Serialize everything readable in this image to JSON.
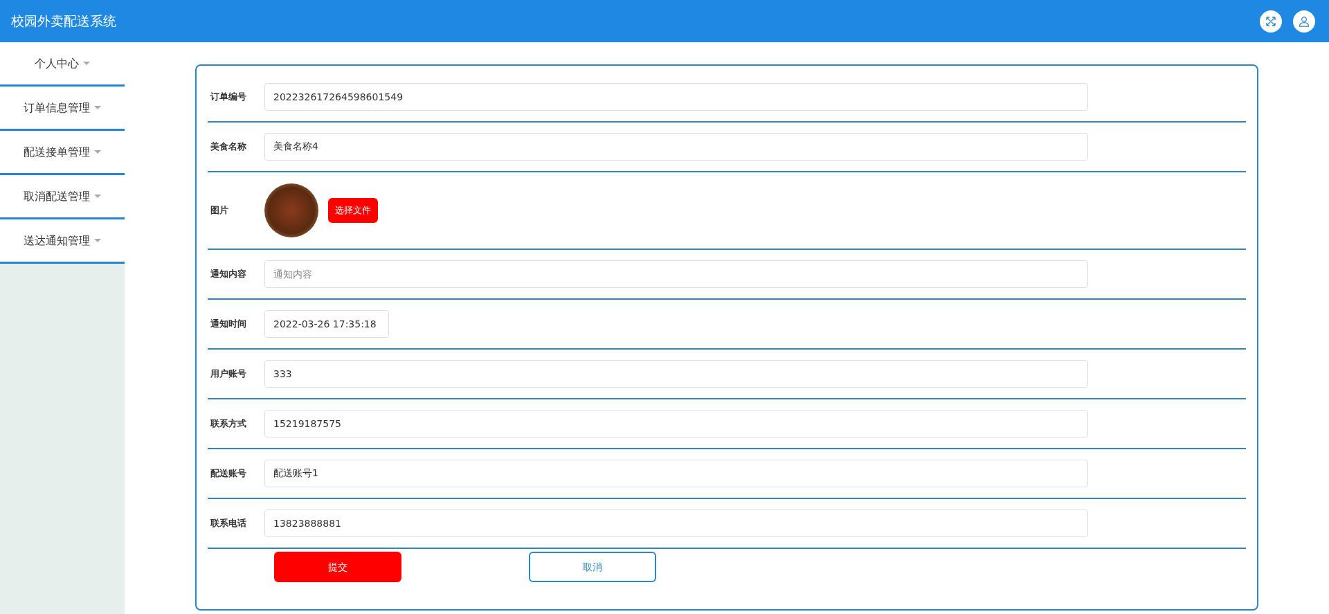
{
  "header": {
    "title": "校园外卖配送系统"
  },
  "sidebar": {
    "items": [
      {
        "label": "个人中心"
      },
      {
        "label": "订单信息管理"
      },
      {
        "label": "配送接单管理"
      },
      {
        "label": "取消配送管理"
      },
      {
        "label": "送达通知管理"
      }
    ]
  },
  "form": {
    "fields": [
      {
        "kind": "text",
        "label": "订单编号",
        "value": "202232617264598601549"
      },
      {
        "kind": "text",
        "label": "美食名称",
        "value": "美食名称4"
      },
      {
        "kind": "image",
        "label": "图片",
        "button": "选择文件"
      },
      {
        "kind": "text",
        "label": "通知内容",
        "placeholder": "通知内容"
      },
      {
        "kind": "datetime",
        "label": "通知时间",
        "value": "2022-03-26 17:35:18"
      },
      {
        "kind": "text",
        "label": "用户账号",
        "value": "333"
      },
      {
        "kind": "text",
        "label": "联系方式",
        "value": "15219187575"
      },
      {
        "kind": "text",
        "label": "配送账号",
        "value": "配送账号1"
      },
      {
        "kind": "text",
        "label": "联系电话",
        "value": "13823888881"
      }
    ],
    "buttons": [
      {
        "kind": "primary",
        "label": "提交"
      },
      {
        "kind": "outline",
        "label": "取消"
      }
    ]
  }
}
